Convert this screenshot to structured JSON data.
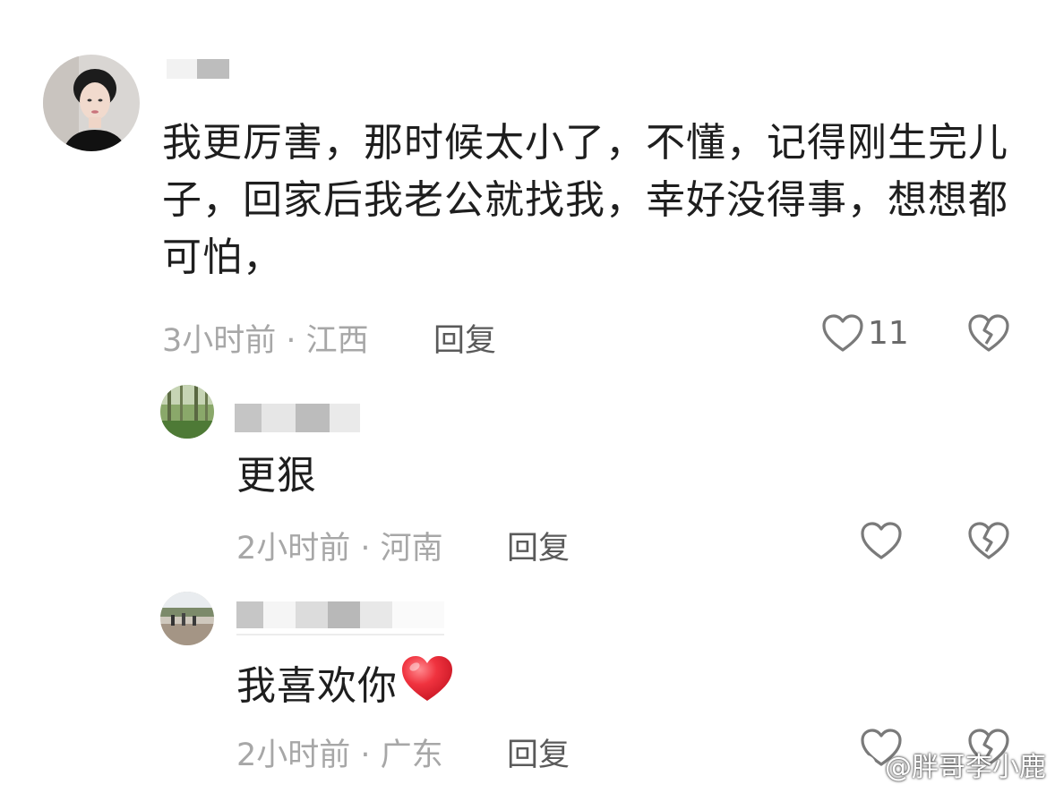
{
  "comments": [
    {
      "text_lines": [
        "我更厉害，那时候太小了，不懂，记得刚生完儿",
        "子，回家后我老公就找我，幸好没得事，想想都",
        "可怕，"
      ],
      "time": "3小时前 · 江西",
      "reply_label": "回复",
      "like_count": "11"
    },
    {
      "text": "更狠",
      "time": "2小时前 · 河南",
      "reply_label": "回复",
      "like_count": ""
    },
    {
      "text": "我喜欢你",
      "time": "2小时前 · 广东",
      "reply_label": "回复",
      "like_count": ""
    }
  ],
  "watermark": "@胖哥李小鹿",
  "icons": {
    "like": "heart-outline-icon",
    "dislike": "broken-heart-icon",
    "emoji": "red-heart-emoji"
  },
  "colors": {
    "meta": "#a7a7a7",
    "reply": "#5a5a5a",
    "text": "#1e1e1e",
    "heart_emoji": "#e8283a"
  }
}
